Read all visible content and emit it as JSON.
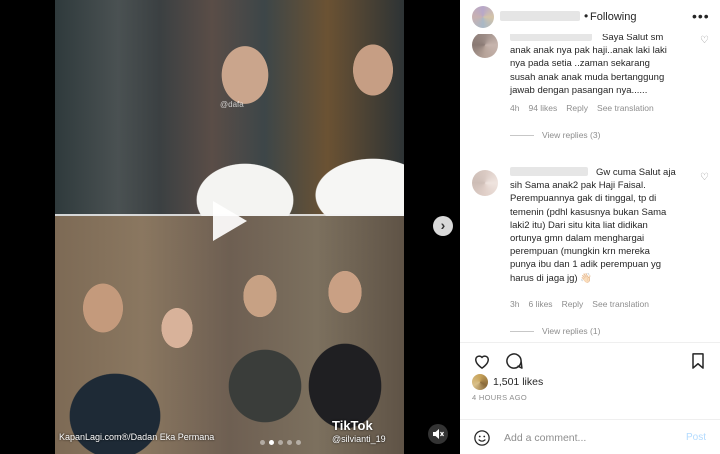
{
  "header": {
    "following_label": "Following",
    "more_icon": "more-horizontal-icon"
  },
  "media": {
    "credit": "KapanLagi.com®/Dadan Eka Permana",
    "tiktok_logo": "TikTok",
    "tiktok_user": "@silvianti_19",
    "watermark": "@dafa",
    "play_icon": "play-icon",
    "next_icon": "chevron-right-icon",
    "mute_icon": "speaker-muted-icon",
    "page_dots": 5,
    "active_dot": 1
  },
  "comments": [
    {
      "text": "Saya Salut sm\nanak anak nya pak haji..anak laki laki\nnya pada setia ..zaman sekarang\nsusah anak anak muda bertanggung\njawab dengan pasangan nya......",
      "time": "4h",
      "likes": "94 likes",
      "reply": "Reply",
      "translate": "See translation",
      "view_replies": "View replies (3)"
    },
    {
      "text": "Gw cuma Salut aja\nsih Sama anak2 pak Haji Faisal.\nPerempuannya gak di tinggal, tp di\ntemenin (pdhl kasusnya bukan Sama\nlaki2 itu) Dari situ kita liat didikan\nortunya gmn dalam menghargai\nperempuan (mungkin krn mereka\npunya ibu dan 1 adik perempuan yg\nharus di jaga jg) 👋🏻",
      "time": "3h",
      "likes": "6 likes",
      "reply": "Reply",
      "translate": "See translation",
      "view_replies": "View replies (1)"
    }
  ],
  "actions": {
    "like_icon": "heart-icon",
    "comment_icon": "comment-bubble-icon",
    "save_icon": "bookmark-icon"
  },
  "likes_count": "1,501 likes",
  "timestamp": "4 HOURS AGO",
  "add_comment": {
    "placeholder": "Add a comment...",
    "post_label": "Post"
  },
  "colors": {
    "post_disabled": "#b3dbff",
    "muted": "#8e8e8e",
    "text": "#262626"
  }
}
